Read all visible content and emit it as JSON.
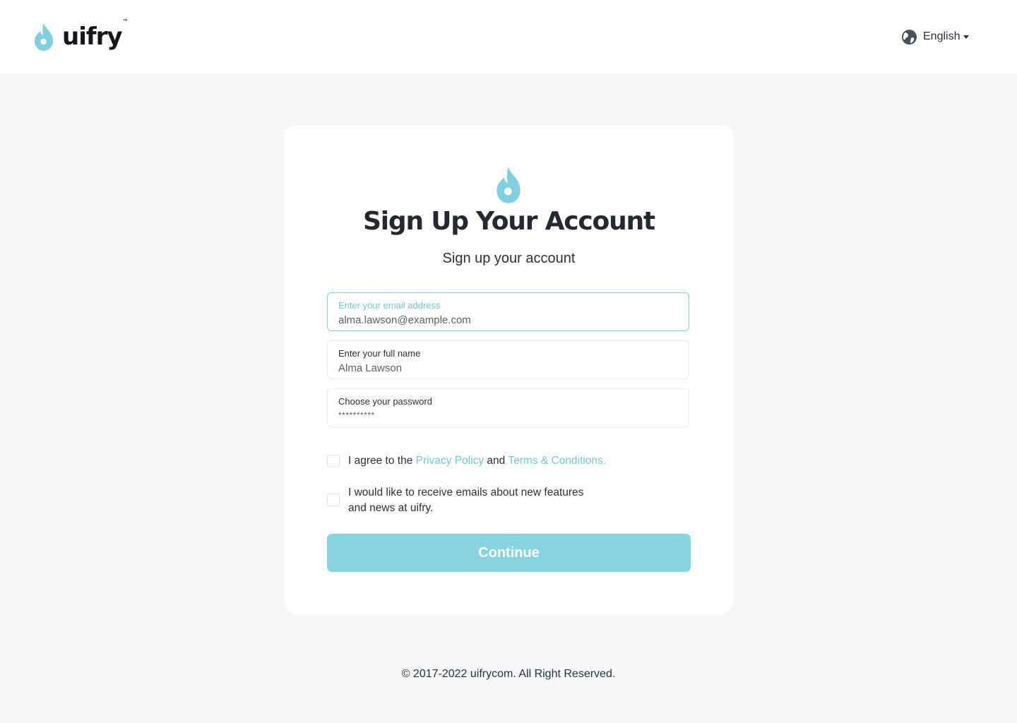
{
  "header": {
    "brand": "uifry",
    "trademark": "™",
    "language": "English"
  },
  "card": {
    "title": "Sign Up Your Account",
    "subtitle": "Sign up your account",
    "fields": [
      {
        "label": "Enter your email address",
        "value": "alma.lawson@example.com"
      },
      {
        "label": "Enter your full name",
        "value": "Alma Lawson"
      },
      {
        "label": "Choose your password",
        "value": "**********"
      }
    ],
    "agree": {
      "prefix": "I agree to the ",
      "privacy_link": "Privacy Policy",
      "middle": " and ",
      "terms_link": "Terms & Conditions."
    },
    "newsletter": {
      "line1": "I would like to receive emails about new features",
      "line2": "and news at uifry."
    },
    "continue_label": "Continue"
  },
  "footer": {
    "copyright": "© 2017-2022  uifrycom. All Right Reserved."
  },
  "colors": {
    "accent": "#86d4e0",
    "link": "#6fc8d8",
    "background": "#f6f7f9",
    "text": "#252833"
  }
}
